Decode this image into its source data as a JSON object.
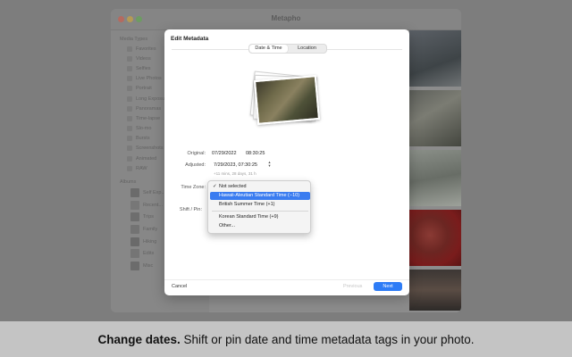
{
  "app": {
    "title": "Metapho",
    "sidebar": {
      "media_types_header": "Media Types",
      "media_types": [
        "Favorites",
        "Videos",
        "Selfies",
        "Live Photos",
        "Portrait",
        "Long Exposure",
        "Panoramas",
        "Time-lapse",
        "Slo-mo",
        "Bursts",
        "Screenshots",
        "Animated",
        "RAW"
      ],
      "albums_header": "Albums",
      "albums": [
        "Self Exp...",
        "Recent...",
        "Trips",
        "Family",
        "Hiking",
        "Edits",
        "Misc"
      ]
    }
  },
  "modal": {
    "title": "Edit Metadata",
    "tabs": [
      {
        "label": "Date & Time",
        "active": true
      },
      {
        "label": "Location",
        "active": false
      }
    ],
    "fields": {
      "original_label": "Original:",
      "original_date": "07/29/2022",
      "original_time": "08:30:25",
      "adjusted_label": "Adjusted:",
      "adjusted_value": "7/29/2023, 07:30:25",
      "adjusted_hint": "+11 mins, 28 days, 31 h",
      "time_zone_label": "Time Zone:",
      "shift_label": "Shift / Pin:"
    },
    "buttons": {
      "cancel": "Cancel",
      "previous": "Previous",
      "next": "Next"
    }
  },
  "time_zone_menu": {
    "items": [
      {
        "label": "Not selected",
        "checked": true,
        "selected": false
      },
      {
        "label": "Hawaii-Aleutian Standard Time (−10)",
        "checked": false,
        "selected": true
      },
      {
        "label": "British Summer Time (+1)",
        "checked": false,
        "selected": false
      },
      {
        "label": "Korean Standard Time (+9)",
        "checked": false,
        "selected": false
      },
      {
        "label": "Other...",
        "checked": false,
        "selected": false
      }
    ],
    "check_symbol": "✓"
  },
  "caption": {
    "bold": "Change dates.",
    "rest": "Shift or pin date and time metadata tags in your photo."
  },
  "colors": {
    "accent": "#2e7cf6",
    "menu_highlight": "#3a7cf0",
    "dimmed_background": "#7d7d7d",
    "caption_band": "#c4c4c4"
  }
}
